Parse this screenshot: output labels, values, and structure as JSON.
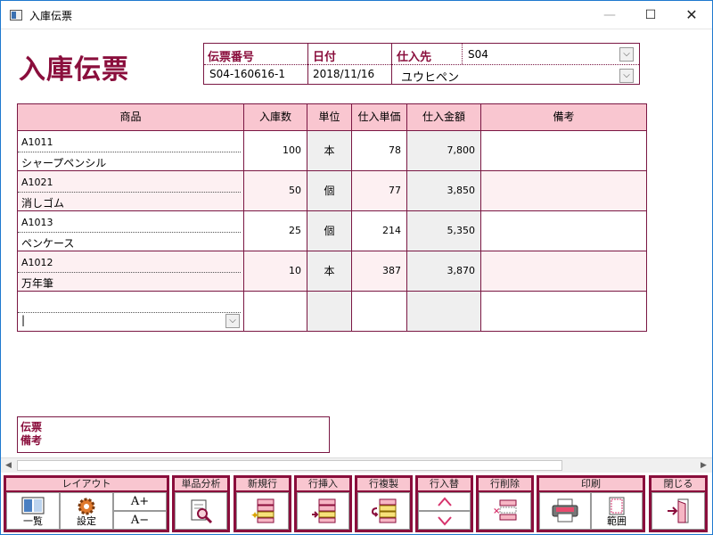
{
  "window": {
    "title": "入庫伝票",
    "minimize": "—",
    "maximize": "☐",
    "close": "✕"
  },
  "page_title": "入庫伝票",
  "header": {
    "slip_no_label": "伝票番号",
    "slip_no_value": "S04-160616-1",
    "date_label": "日付",
    "date_value": "2018/11/16",
    "supplier_label": "仕入先",
    "supplier_code": "S04",
    "supplier_name": "ユウヒペン"
  },
  "grid": {
    "columns": [
      "商品",
      "入庫数",
      "単位",
      "仕入単価",
      "仕入金額",
      "備考"
    ],
    "rows": [
      {
        "code": "A1011",
        "name": "シャープペンシル",
        "qty": "100",
        "unit": "本",
        "price": "78",
        "amount": "7,800",
        "memo": ""
      },
      {
        "code": "A1021",
        "name": "消しゴム",
        "qty": "50",
        "unit": "個",
        "price": "77",
        "amount": "3,850",
        "memo": ""
      },
      {
        "code": "A1013",
        "name": "ペンケース",
        "qty": "25",
        "unit": "個",
        "price": "214",
        "amount": "5,350",
        "memo": ""
      },
      {
        "code": "A1012",
        "name": "万年筆",
        "qty": "10",
        "unit": "本",
        "price": "387",
        "amount": "3,870",
        "memo": ""
      }
    ],
    "new_row_value": "|"
  },
  "memo_label": "伝票\n備考",
  "toolbar": {
    "layout_label": "レイアウト",
    "list_caption": "一覧",
    "settings_caption": "設定",
    "font_up": "A+",
    "font_down": "A−",
    "analysis_label": "単品分析",
    "new_row_label": "新規行",
    "insert_row_label": "行挿入",
    "copy_row_label": "行複製",
    "swap_row_label": "行入替",
    "delete_row_label": "行削除",
    "print_label": "印刷",
    "range_caption": "範囲",
    "close_label": "閉じる"
  },
  "colors": {
    "accent": "#8a0e3c",
    "header_bg": "#f9c6d0",
    "border": "#7a1743"
  }
}
